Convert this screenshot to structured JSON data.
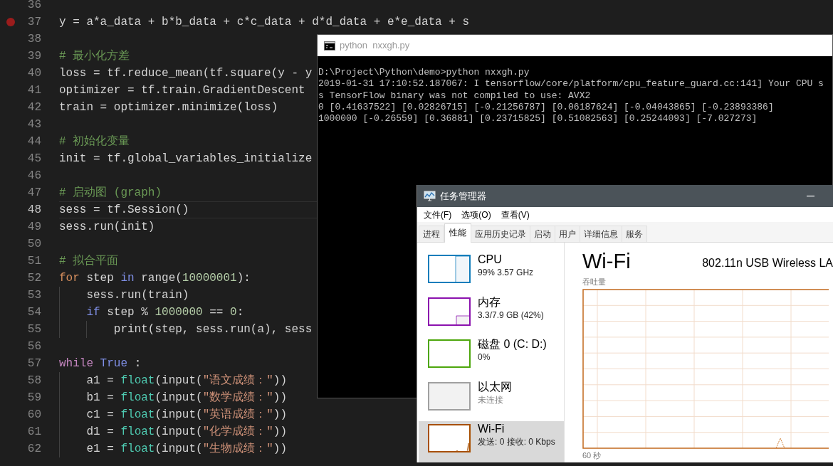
{
  "editor": {
    "lines": [
      {
        "number": "36",
        "breakpoint": false,
        "current": false
      },
      {
        "number": "37",
        "breakpoint": true,
        "current": false,
        "tokens": [
          {
            "kind": "plain",
            "text": "y = a*a_data + b*b_data + c*c_data + d*d_data + e*e_data + s"
          }
        ]
      },
      {
        "number": "38",
        "breakpoint": false,
        "current": false
      },
      {
        "number": "39",
        "breakpoint": false,
        "current": false,
        "tokens": [
          {
            "kind": "comment",
            "text": "# 最小化方差"
          }
        ]
      },
      {
        "number": "40",
        "breakpoint": false,
        "current": false,
        "tokens": [
          {
            "kind": "plain",
            "text": "loss = tf.reduce_mean(tf.square(y - y"
          }
        ]
      },
      {
        "number": "41",
        "breakpoint": false,
        "current": false,
        "tokens": [
          {
            "kind": "plain",
            "text": "optimizer = tf.train.GradientDescent"
          }
        ]
      },
      {
        "number": "42",
        "breakpoint": false,
        "current": false,
        "tokens": [
          {
            "kind": "plain",
            "text": "train = optimizer.minimize(loss)"
          }
        ]
      },
      {
        "number": "43",
        "breakpoint": false,
        "current": false
      },
      {
        "number": "44",
        "breakpoint": false,
        "current": false,
        "tokens": [
          {
            "kind": "comment",
            "text": "# 初始化变量"
          }
        ]
      },
      {
        "number": "45",
        "breakpoint": false,
        "current": false,
        "tokens": [
          {
            "kind": "plain",
            "text": "init = tf.global_variables_initialize"
          }
        ]
      },
      {
        "number": "46",
        "breakpoint": false,
        "current": false
      },
      {
        "number": "47",
        "breakpoint": false,
        "current": false,
        "tokens": [
          {
            "kind": "comment",
            "text": "# 启动图 (graph)"
          }
        ]
      },
      {
        "number": "48",
        "breakpoint": false,
        "current": true,
        "tokens": [
          {
            "kind": "plain",
            "text": "sess = tf.Session()"
          }
        ]
      },
      {
        "number": "49",
        "breakpoint": false,
        "current": false,
        "tokens": [
          {
            "kind": "plain",
            "text": "sess.run(init)"
          }
        ]
      },
      {
        "number": "50",
        "breakpoint": false,
        "current": false
      },
      {
        "number": "51",
        "breakpoint": false,
        "current": false,
        "tokens": [
          {
            "kind": "comment",
            "text": "# 拟合平面"
          }
        ]
      },
      {
        "number": "52",
        "breakpoint": false,
        "current": false,
        "tokens": [
          {
            "kind": "control",
            "text": "for"
          },
          {
            "kind": "plain",
            "text": " step "
          },
          {
            "kind": "builtin",
            "text": "in"
          },
          {
            "kind": "plain",
            "text": " range("
          },
          {
            "kind": "number",
            "text": "10000001"
          },
          {
            "kind": "plain",
            "text": "):"
          }
        ]
      },
      {
        "number": "53",
        "breakpoint": false,
        "current": false,
        "tokens": [
          {
            "kind": "plain",
            "text": "    sess.run(train)"
          }
        ]
      },
      {
        "number": "54",
        "breakpoint": false,
        "current": false,
        "tokens": [
          {
            "kind": "builtin",
            "text": "    if"
          },
          {
            "kind": "plain",
            "text": " step % "
          },
          {
            "kind": "number",
            "text": "1000000"
          },
          {
            "kind": "plain",
            "text": " == "
          },
          {
            "kind": "number",
            "text": "0"
          },
          {
            "kind": "plain",
            "text": ":"
          }
        ]
      },
      {
        "number": "55",
        "breakpoint": false,
        "current": false,
        "tokens": [
          {
            "kind": "plain",
            "text": "        print(step, sess.run(a), sess"
          }
        ]
      },
      {
        "number": "56",
        "breakpoint": false,
        "current": false
      },
      {
        "number": "57",
        "breakpoint": false,
        "current": false,
        "tokens": [
          {
            "kind": "keyword",
            "text": "while"
          },
          {
            "kind": "builtin",
            "text": " True"
          },
          {
            "kind": "plain",
            "text": " :"
          }
        ]
      },
      {
        "number": "58",
        "breakpoint": false,
        "current": false,
        "tokens": [
          {
            "kind": "plain",
            "text": "    a1 = "
          },
          {
            "kind": "function",
            "text": "float"
          },
          {
            "kind": "plain",
            "text": "(input("
          },
          {
            "kind": "string",
            "text": "\"语文成绩：\""
          },
          {
            "kind": "plain",
            "text": "))"
          }
        ]
      },
      {
        "number": "59",
        "breakpoint": false,
        "current": false,
        "tokens": [
          {
            "kind": "plain",
            "text": "    b1 = "
          },
          {
            "kind": "function",
            "text": "float"
          },
          {
            "kind": "plain",
            "text": "(input("
          },
          {
            "kind": "string",
            "text": "\"数学成绩：\""
          },
          {
            "kind": "plain",
            "text": "))"
          }
        ]
      },
      {
        "number": "60",
        "breakpoint": false,
        "current": false,
        "tokens": [
          {
            "kind": "plain",
            "text": "    c1 = "
          },
          {
            "kind": "function",
            "text": "float"
          },
          {
            "kind": "plain",
            "text": "(input("
          },
          {
            "kind": "string",
            "text": "\"英语成绩：\""
          },
          {
            "kind": "plain",
            "text": "))"
          }
        ]
      },
      {
        "number": "61",
        "breakpoint": false,
        "current": false,
        "tokens": [
          {
            "kind": "plain",
            "text": "    d1 = "
          },
          {
            "kind": "function",
            "text": "float"
          },
          {
            "kind": "plain",
            "text": "(input("
          },
          {
            "kind": "string",
            "text": "\"化学成绩：\""
          },
          {
            "kind": "plain",
            "text": "))"
          }
        ]
      },
      {
        "number": "62",
        "breakpoint": false,
        "current": false,
        "tokens": [
          {
            "kind": "plain",
            "text": "    e1 = "
          },
          {
            "kind": "function",
            "text": "float"
          },
          {
            "kind": "plain",
            "text": "(input("
          },
          {
            "kind": "string",
            "text": "\"生物成绩：\""
          },
          {
            "kind": "plain",
            "text": "))"
          }
        ]
      }
    ]
  },
  "console": {
    "title": "python  nxxgh.py",
    "lines": [
      "D:\\Project\\Python\\demo>python nxxgh.py",
      "2019-01-31 17:10:52.187067: I tensorflow/core/platform/cpu_feature_guard.cc:141] Your CPU s",
      "s TensorFlow binary was not compiled to use: AVX2",
      "0 [0.41637522] [0.02826715] [-0.21256787] [0.06187624] [-0.04043865] [-0.23893386]",
      "1000000 [-0.26559] [0.36881] [0.23715825] [0.51082563] [0.25244093] [-7.027273]"
    ]
  },
  "task_manager": {
    "title": "任务管理器",
    "menu": [
      "文件(F)",
      "选项(O)",
      "查看(V)"
    ],
    "tabs": [
      {
        "label": "进程",
        "selected": false
      },
      {
        "label": "性能",
        "selected": true
      },
      {
        "label": "应用历史记录",
        "selected": false
      },
      {
        "label": "启动",
        "selected": false
      },
      {
        "label": "用户",
        "selected": false
      },
      {
        "label": "详细信息",
        "selected": false
      },
      {
        "label": "服务",
        "selected": false
      }
    ],
    "resources": [
      {
        "kind": "cpu",
        "name": "CPU",
        "detail": "99% 3.57 GHz",
        "color": "#117dbb",
        "connected": true,
        "selected": false
      },
      {
        "kind": "memory",
        "name": "内存",
        "detail": "3.3/7.9 GB (42%)",
        "color": "#8b12ae",
        "connected": true,
        "selected": false
      },
      {
        "kind": "disk",
        "name": "磁盘 0 (C: D:)",
        "detail": "0%",
        "color": "#4da60c",
        "connected": true,
        "selected": false
      },
      {
        "kind": "ethernet",
        "name": "以太网",
        "detail": "未连接",
        "color": "#a0a0a0",
        "connected": false,
        "selected": false
      },
      {
        "kind": "wifi",
        "name": "Wi-Fi",
        "detail": "发送: 0 接收: 0 Kbps",
        "color": "#a74f01",
        "connected": true,
        "selected": true
      }
    ],
    "detail": {
      "title": "Wi-Fi",
      "adapter": "802.11n USB Wireless LA",
      "graph_label": "吞吐量",
      "time_label": "60 秒"
    }
  }
}
